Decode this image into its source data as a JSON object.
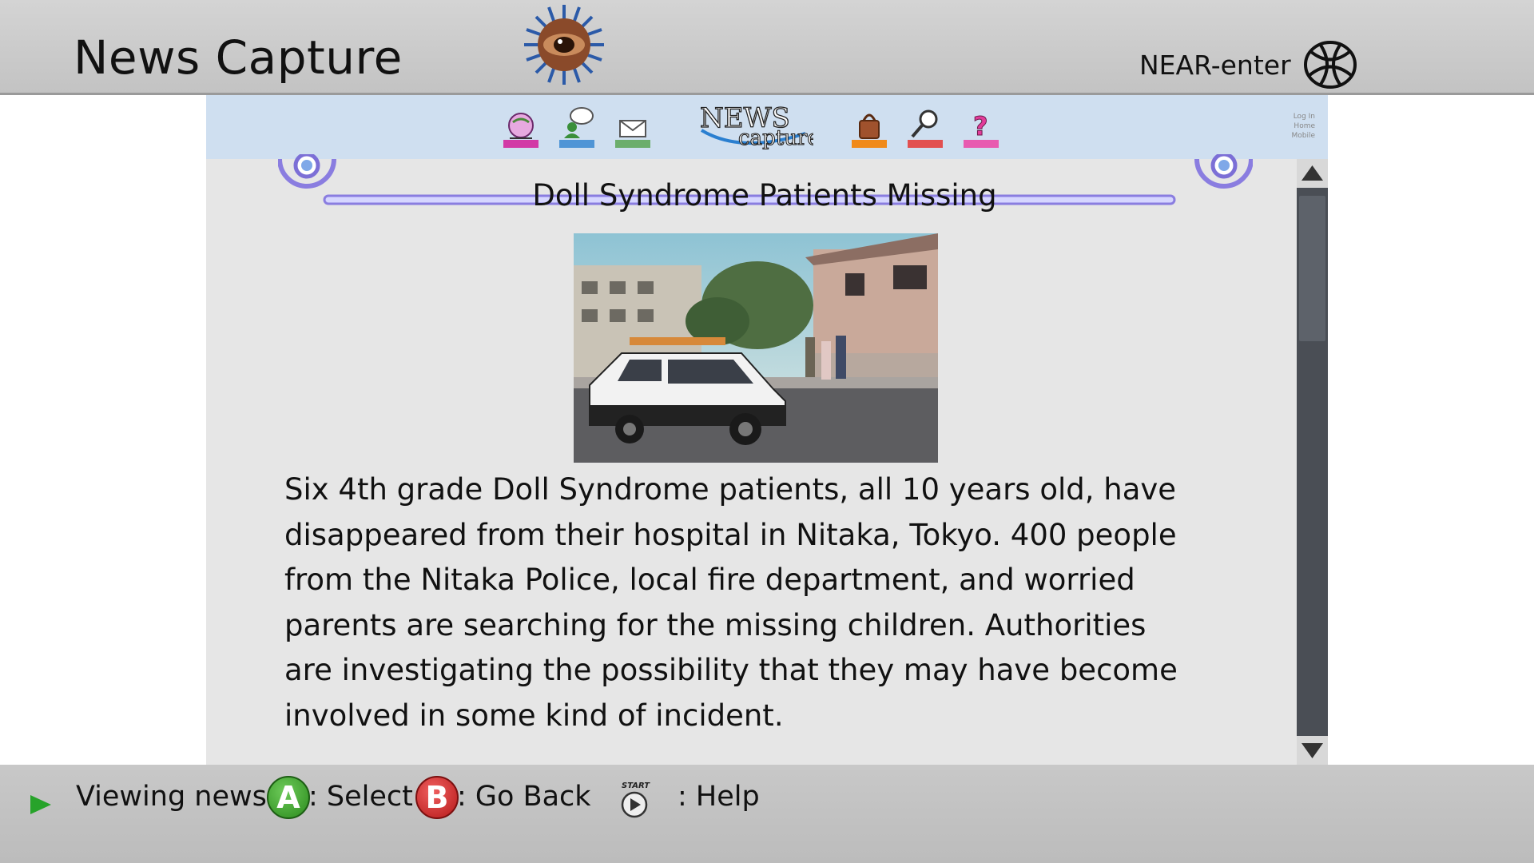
{
  "header": {
    "app_title": "News Capture",
    "network_label": "NEAR-enter",
    "logo_icon": "eye-logo-icon",
    "globe_icon": "globe-icon"
  },
  "navbar": {
    "icons": [
      "home-globe-icon",
      "chat-user-icon",
      "mail-icon",
      "shopping-bag-icon",
      "search-icon",
      "help-icon"
    ],
    "logo_text_top": "NEWS",
    "logo_text_bottom": "capture",
    "links": [
      "Log In",
      "Home",
      "Mobile"
    ]
  },
  "article": {
    "title": "Doll Syndrome Patients Missing",
    "body": "Six 4th grade Doll Syndrome patients, all 10 years old, have disappeared from their hospital in Nitaka, Tokyo. 400 people from the Nitaka Police, local fire department, and worried parents are searching for the missing children. Authorities are investigating the possibility that they may have become involved in some kind of incident."
  },
  "status_bar": {
    "message": "Viewing news.",
    "a_button": "A",
    "a_label": ": Select",
    "b_button": "B",
    "b_label": ": Go Back",
    "start_label": "START",
    "help_label": ": Help"
  },
  "colors": {
    "navbar_bg": "#cfdff0",
    "content_bg": "#e6e6e6",
    "title_ring": "#7c6fd6",
    "scrollbar": "#4a4e55"
  }
}
